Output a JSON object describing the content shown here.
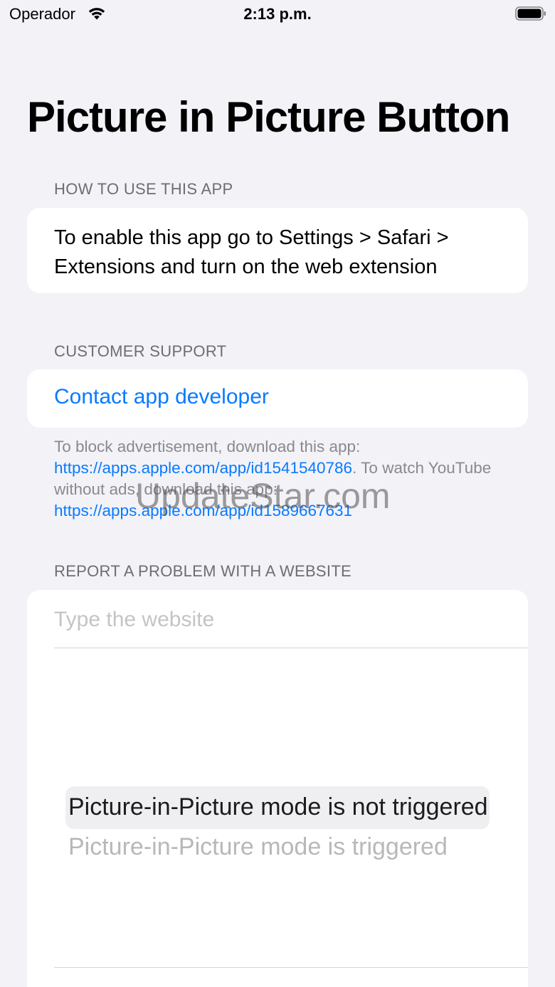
{
  "status_bar": {
    "carrier": "Operador",
    "time": "2:13 p.m.",
    "wifi_icon": "wifi-icon",
    "battery_icon": "battery-full-icon"
  },
  "title": "Picture in Picture Button",
  "how_to": {
    "header": "HOW TO USE THIS APP",
    "text": "To enable this app go to Settings > Safari > Extensions and turn on the web extension"
  },
  "support": {
    "header": "CUSTOMER SUPPORT",
    "contact_label": "Contact app developer",
    "footer": {
      "text_1": "To block advertisement, download this app: ",
      "link_1": "https://apps.apple.com/app/id1541540786",
      "text_2": ". To watch YouTube without ads, download this app: ",
      "link_2": "https://apps.apple.com/app/id1589667631"
    }
  },
  "watermark": "UpdateStar.com",
  "report": {
    "header": "REPORT A PROBLEM WITH A WEBSITE",
    "website_placeholder": "Type the website",
    "website_value": "",
    "options": [
      "Picture-in-Picture mode is not triggered",
      "Picture-in-Picture mode is triggered"
    ],
    "selected_index": 0
  },
  "colors": {
    "background": "#f2f2f7",
    "card": "#ffffff",
    "accent_link": "#0a7aff",
    "secondary_text": "#6d6d72"
  }
}
